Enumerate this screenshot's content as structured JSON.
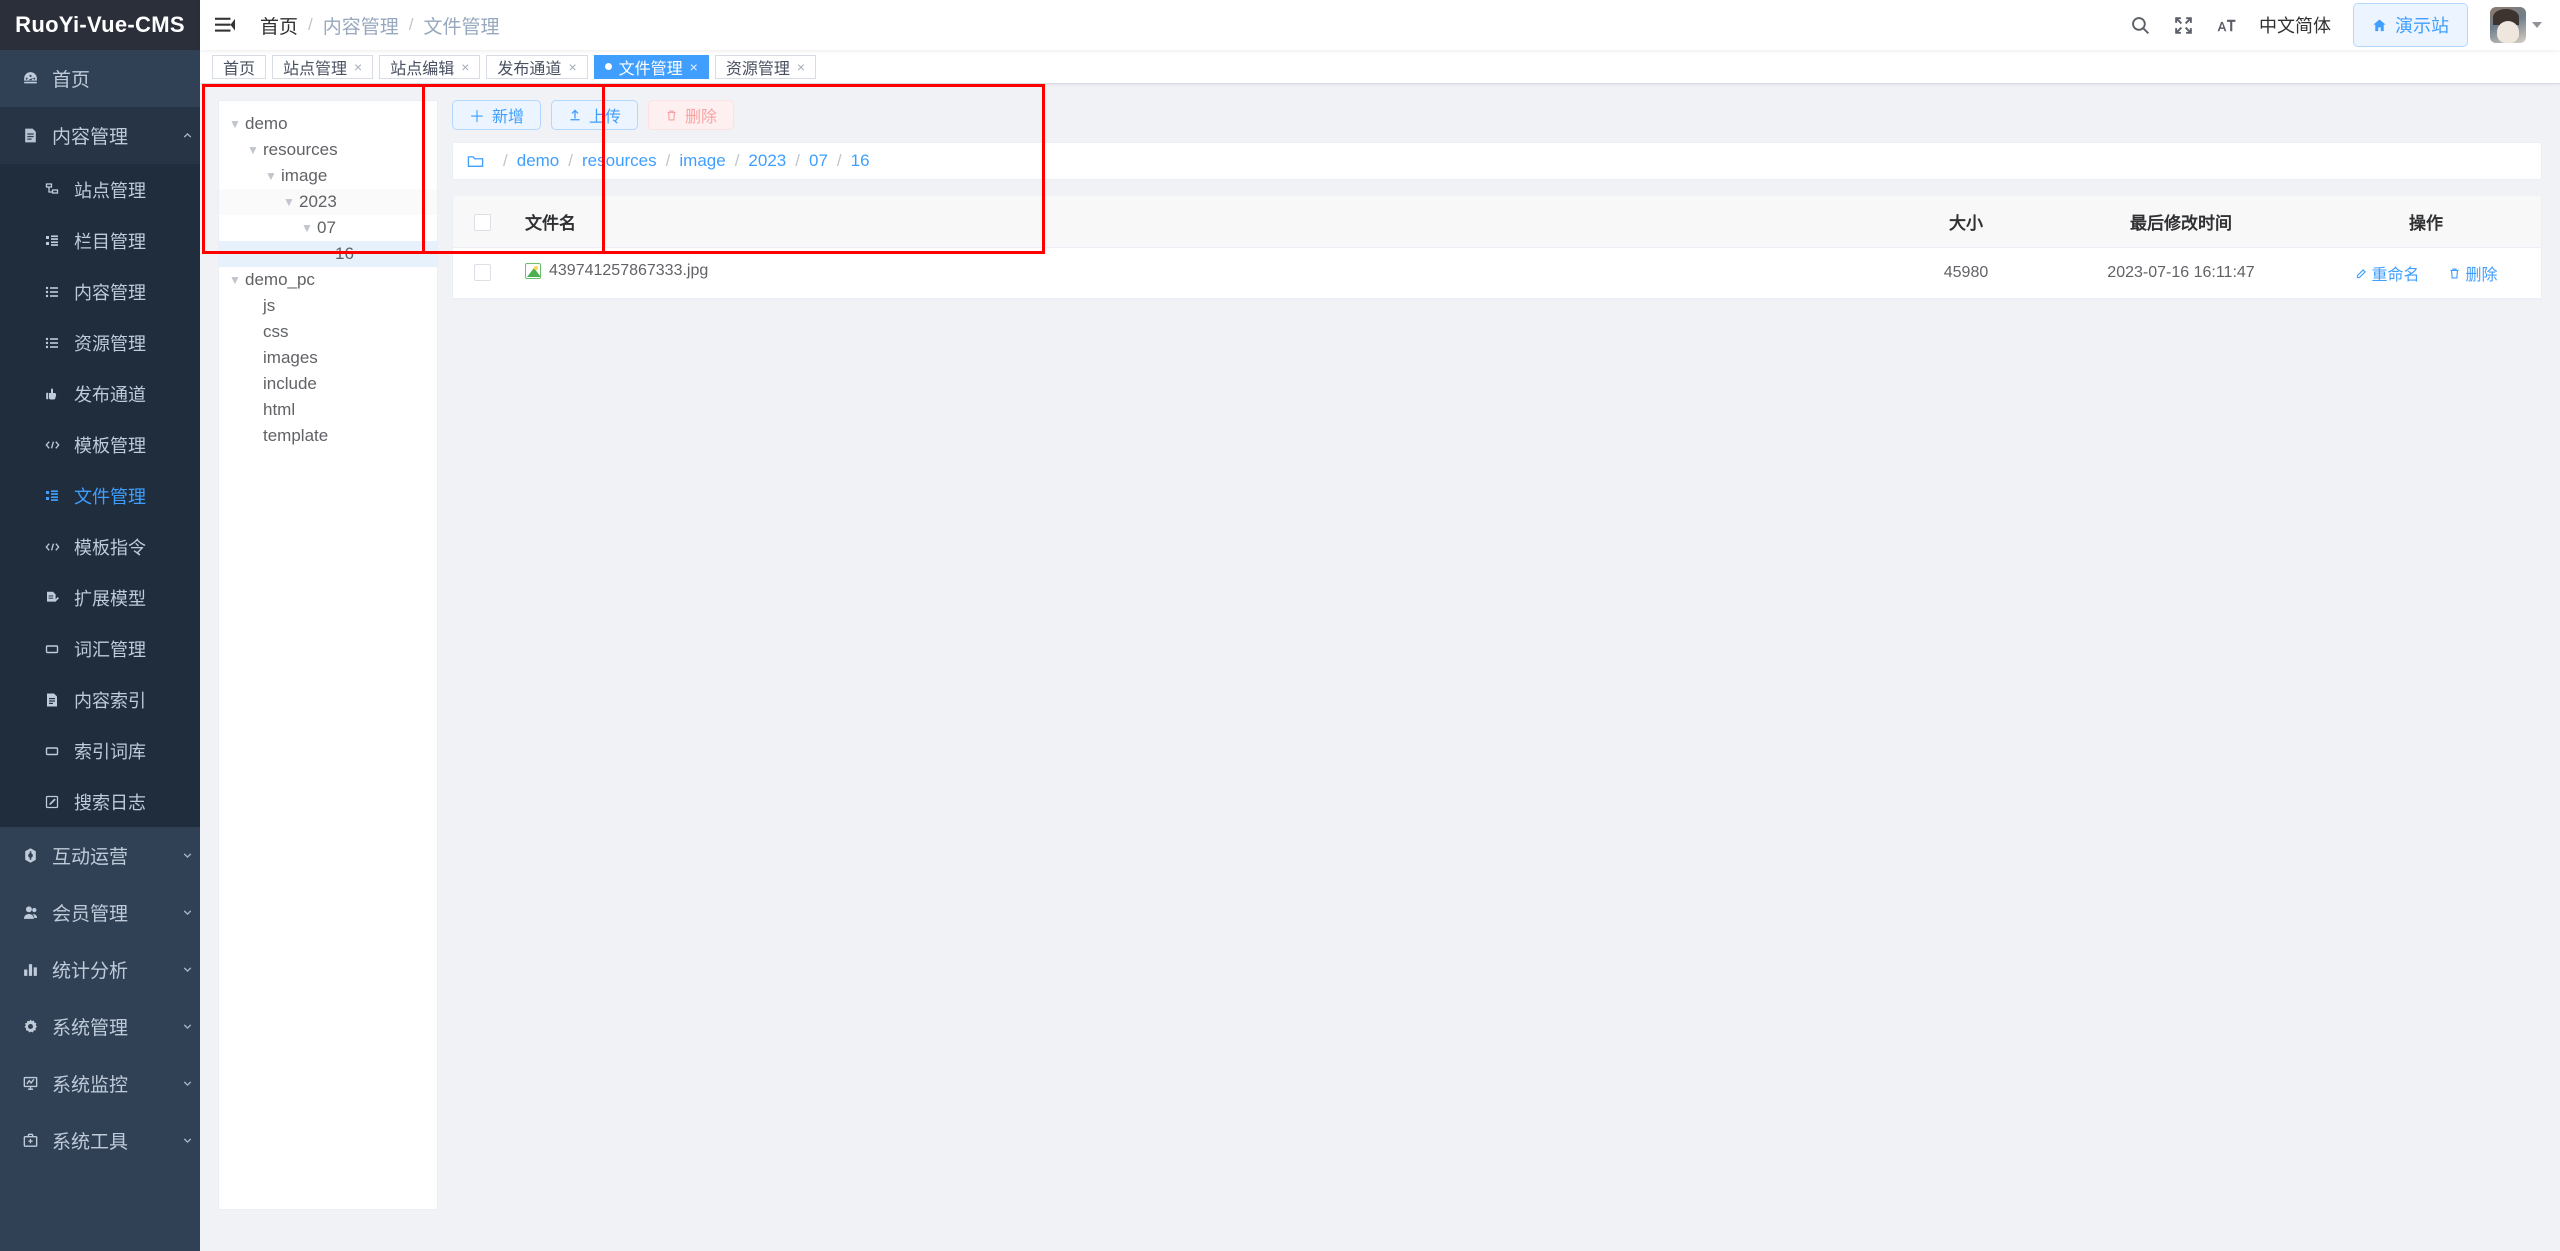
{
  "brand": {
    "title": "RuoYi-Vue-CMS"
  },
  "sidebar": {
    "items": [
      {
        "label": "首页",
        "icon": "dashboard-icon",
        "type": "item"
      },
      {
        "label": "内容管理",
        "icon": "document-icon",
        "type": "group",
        "open": true,
        "children": [
          {
            "label": "站点管理",
            "icon": "site-icon"
          },
          {
            "label": "栏目管理",
            "icon": "tree-icon"
          },
          {
            "label": "内容管理",
            "icon": "list-icon"
          },
          {
            "label": "资源管理",
            "icon": "list-icon"
          },
          {
            "label": "发布通道",
            "icon": "publish-icon"
          },
          {
            "label": "模板管理",
            "icon": "code-icon"
          },
          {
            "label": "文件管理",
            "icon": "tree-icon",
            "active": true
          },
          {
            "label": "模板指令",
            "icon": "code-icon"
          },
          {
            "label": "扩展模型",
            "icon": "form-icon"
          },
          {
            "label": "词汇管理",
            "icon": "square-icon"
          },
          {
            "label": "内容索引",
            "icon": "document-icon"
          },
          {
            "label": "索引词库",
            "icon": "square-icon"
          },
          {
            "label": "搜索日志",
            "icon": "edit-icon"
          }
        ]
      },
      {
        "label": "互动运营",
        "icon": "interaction-icon",
        "type": "group",
        "open": false
      },
      {
        "label": "会员管理",
        "icon": "user-icon",
        "type": "group",
        "open": false
      },
      {
        "label": "统计分析",
        "icon": "chart-icon",
        "type": "group",
        "open": false
      },
      {
        "label": "系统管理",
        "icon": "gear-icon",
        "type": "group",
        "open": false
      },
      {
        "label": "系统监控",
        "icon": "monitor-icon",
        "type": "group",
        "open": false
      },
      {
        "label": "系统工具",
        "icon": "tools-icon",
        "type": "group",
        "open": false
      }
    ]
  },
  "navbar": {
    "hamburger_icon": "hamburger-icon",
    "breadcrumb": [
      {
        "label": "首页",
        "type": "first"
      },
      {
        "label": "内容管理",
        "type": "link"
      },
      {
        "label": "文件管理",
        "type": "current"
      }
    ],
    "separator": "/",
    "icons": [
      {
        "name": "search-icon"
      },
      {
        "name": "fullscreen-icon"
      },
      {
        "name": "font-size-icon"
      }
    ],
    "language": "中文简体",
    "demo_button": {
      "label": "演示站",
      "icon": "home-icon"
    },
    "avatar": "user-avatar"
  },
  "tabs": [
    {
      "label": "首页",
      "closable": false,
      "active": false
    },
    {
      "label": "站点管理",
      "closable": true,
      "active": false
    },
    {
      "label": "站点编辑",
      "closable": true,
      "active": false
    },
    {
      "label": "发布通道",
      "closable": true,
      "active": false
    },
    {
      "label": "文件管理",
      "closable": true,
      "active": true
    },
    {
      "label": "资源管理",
      "closable": true,
      "active": false
    }
  ],
  "tab_close_glyph": "×",
  "tree": [
    {
      "label": "demo",
      "depth": 0,
      "caret": true,
      "row": "plain"
    },
    {
      "label": "resources",
      "depth": 1,
      "caret": true,
      "row": "plain"
    },
    {
      "label": "image",
      "depth": 2,
      "caret": true,
      "row": "plain"
    },
    {
      "label": "2023",
      "depth": 3,
      "caret": true,
      "row": "alt"
    },
    {
      "label": "07",
      "depth": 4,
      "caret": true,
      "row": "plain"
    },
    {
      "label": "16",
      "depth": 5,
      "caret": false,
      "row": "selected"
    },
    {
      "label": "demo_pc",
      "depth": 0,
      "caret": true,
      "row": "plain"
    },
    {
      "label": "js",
      "depth": 1,
      "caret": false,
      "row": "plain"
    },
    {
      "label": "css",
      "depth": 1,
      "caret": false,
      "row": "plain"
    },
    {
      "label": "images",
      "depth": 1,
      "caret": false,
      "row": "plain"
    },
    {
      "label": "include",
      "depth": 1,
      "caret": false,
      "row": "plain"
    },
    {
      "label": "html",
      "depth": 1,
      "caret": false,
      "row": "plain"
    },
    {
      "label": "template",
      "depth": 1,
      "caret": false,
      "row": "plain"
    }
  ],
  "toolbar": {
    "add_label": "新增",
    "add_icon": "plus-icon",
    "upload_label": "上传",
    "upload_icon": "upload-icon",
    "delete_label": "删除",
    "delete_icon": "trash-icon"
  },
  "path_bar": {
    "folder_icon": "folder-icon",
    "leading_sep": "/",
    "segments": [
      "demo",
      "resources",
      "image",
      "2023",
      "07",
      "16"
    ],
    "separator": "/"
  },
  "table": {
    "headers": {
      "name": "文件名",
      "size": "大小",
      "modified": "最后修改时间",
      "action": "操作"
    },
    "rows": [
      {
        "name": "439741257867333.jpg",
        "file_icon": "image-file-icon",
        "size": "45980",
        "modified": "2023-07-16 16:11:47",
        "rename_label": "重命名",
        "rename_icon": "edit-icon",
        "delete_label": "删除",
        "delete_icon": "trash-icon"
      }
    ]
  },
  "colors": {
    "accent": "#409eff",
    "sidebar_bg": "#304156",
    "submenu_bg": "#1f2d3d",
    "annotation_red": "#ff0000",
    "tree_selected": "#e6f1fc"
  }
}
